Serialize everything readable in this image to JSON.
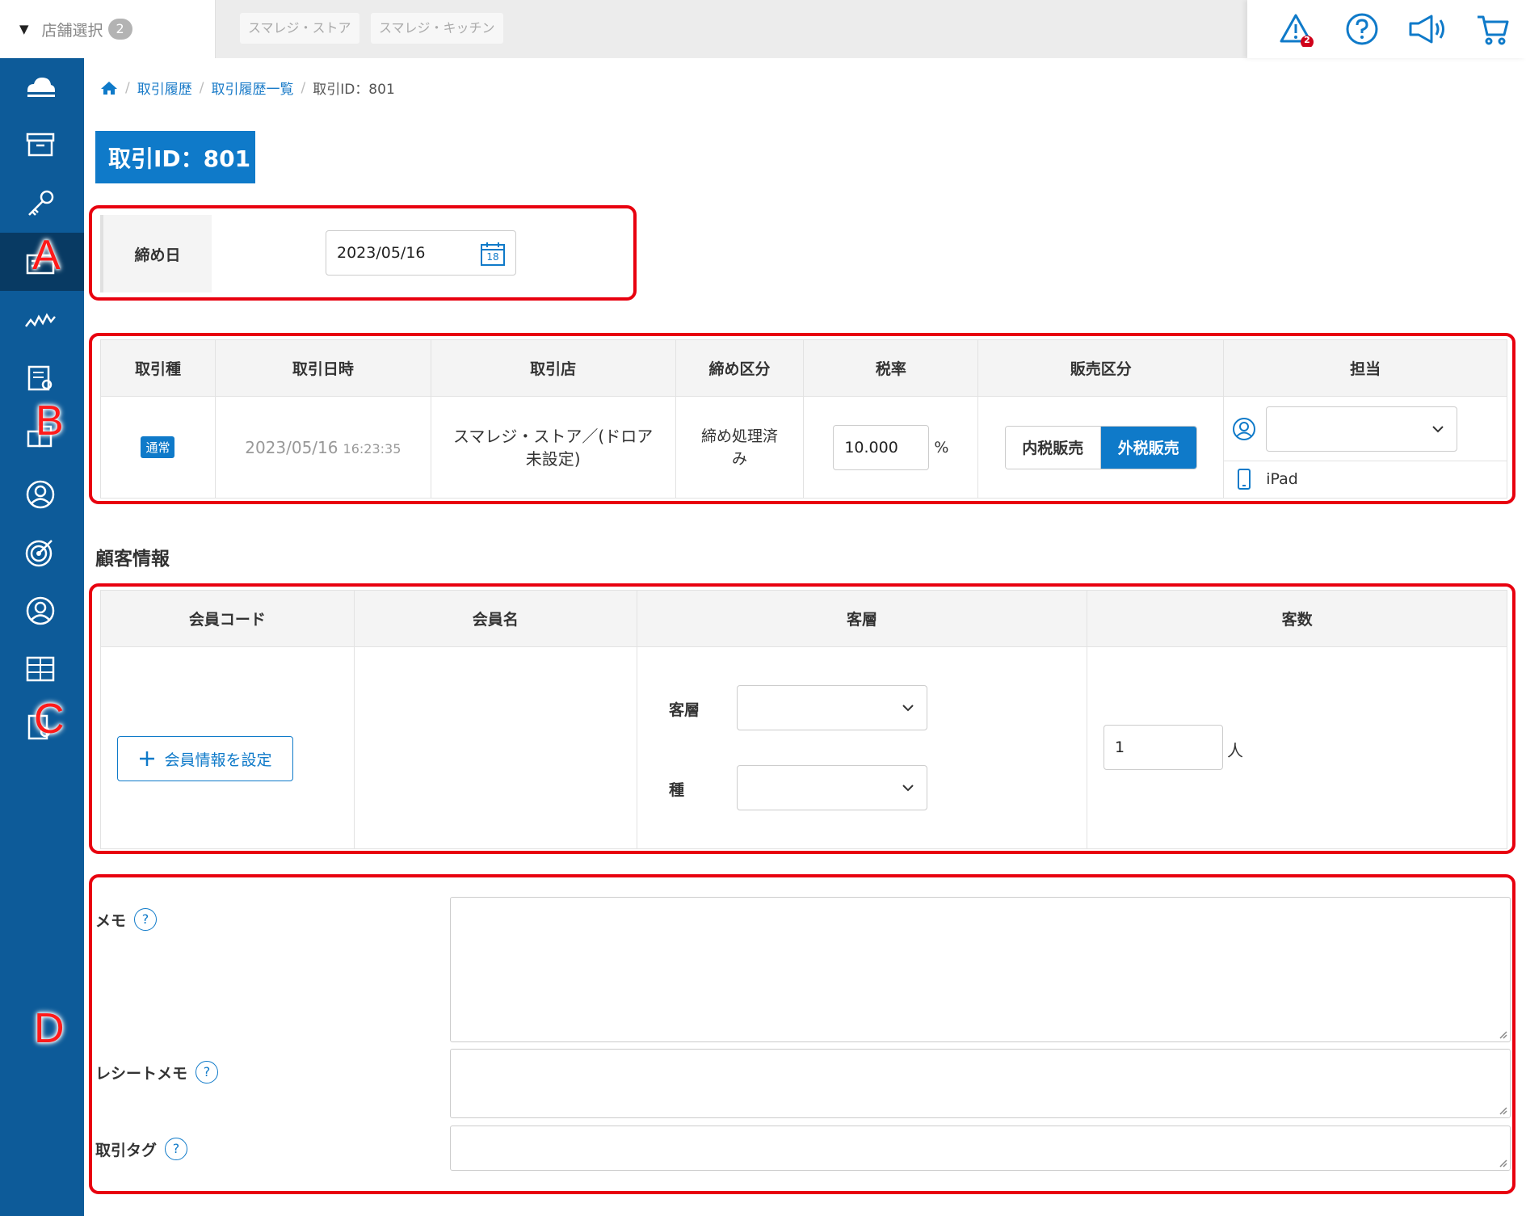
{
  "topbar": {
    "store_select_label": "店舗選択",
    "store_count": "2",
    "store_chips": [
      "スマレジ・ストア",
      "スマレジ・キッチン"
    ],
    "alert_count": "2"
  },
  "annotations": [
    "A",
    "B",
    "C",
    "D"
  ],
  "breadcrumb": {
    "items": [
      "取引履歴",
      "取引履歴一覧"
    ],
    "current": "取引ID：801",
    "separator": "/"
  },
  "page_title": "取引ID：801",
  "closing": {
    "label": "締め日",
    "date_value": "2023/05/16",
    "calendar_day": "18"
  },
  "transaction": {
    "headers": [
      "取引種",
      "取引日時",
      "取引店",
      "締め区分",
      "税率",
      "販売区分",
      "担当"
    ],
    "type_badge": "通常",
    "date": "2023/05/16",
    "time": "16:23:35",
    "store_line1": "スマレジ・ストア／(ドロア",
    "store_line2": "未設定)",
    "closing_status_line1": "締め処理済",
    "closing_status_line2": "み",
    "tax_rate": "10.000",
    "tax_unit": "%",
    "sales_type_options": [
      "内税販売",
      "外税販売"
    ],
    "sales_type_selected": "外税販売",
    "staff_value": "",
    "device": "iPad"
  },
  "customer": {
    "section_title": "顧客情報",
    "headers": [
      "会員コード",
      "会員名",
      "客層",
      "客数"
    ],
    "set_member_button": "会員情報を設定",
    "segment_label": "客層",
    "type_label": "種",
    "segment_value": "",
    "type_value": "",
    "count_value": "1",
    "count_unit": "人"
  },
  "memo": {
    "memo_label": "メモ",
    "receipt_memo_label": "レシートメモ",
    "tag_label": "取引タグ",
    "help_glyph": "?"
  },
  "colors": {
    "primary": "#0f7ac9",
    "sidebar": "#0d5b99",
    "annotation_red": "#e8000f"
  }
}
